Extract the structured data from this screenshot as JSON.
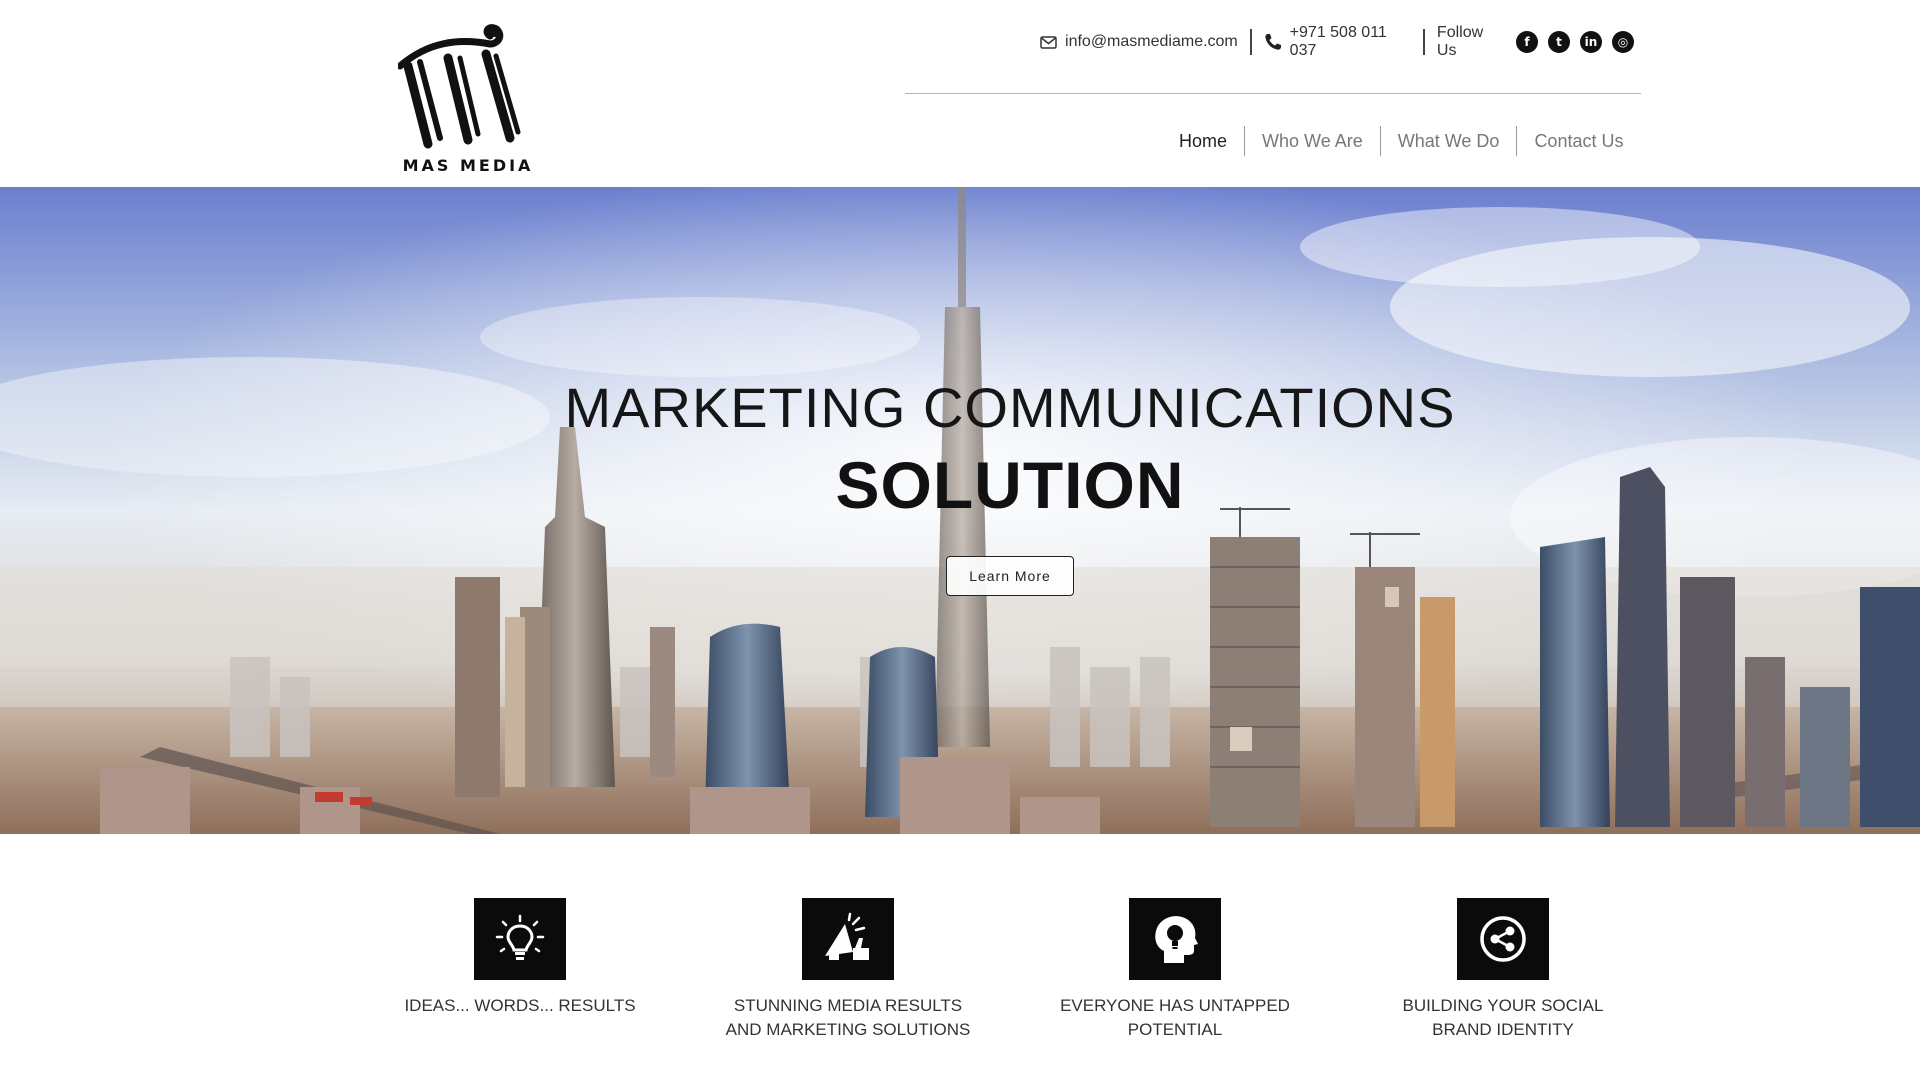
{
  "header": {
    "logo_text": "MAS MEDIA",
    "contact": {
      "email": "info@masmediame.com",
      "phone": "+971 508 011 037",
      "follow_label": "Follow Us",
      "social": [
        {
          "icon": "facebook-icon",
          "glyph": "f"
        },
        {
          "icon": "twitter-icon",
          "glyph": "t"
        },
        {
          "icon": "linkedin-icon",
          "glyph": "in"
        },
        {
          "icon": "instagram-icon",
          "glyph": "◎"
        }
      ]
    },
    "nav": [
      {
        "label": "Home",
        "active": true
      },
      {
        "label": "Who We Are",
        "active": false
      },
      {
        "label": "What We Do",
        "active": false
      },
      {
        "label": "Contact Us",
        "active": false
      }
    ]
  },
  "hero": {
    "title_line1": "MARKETING COMMUNICATIONS",
    "title_line2": "SOLUTION",
    "button_label": "Learn More"
  },
  "features": [
    {
      "icon": "lightbulb-icon",
      "label_line1": "IDEAS... WORDS... RESULTS",
      "label_line2": ""
    },
    {
      "icon": "megaphone-icon",
      "label_line1": "STUNNING MEDIA RESULTS",
      "label_line2": "AND MARKETING SOLUTIONS"
    },
    {
      "icon": "head-bulb-icon",
      "label_line1": "EVERYONE HAS UNTAPPED",
      "label_line2": "POTENTIAL"
    },
    {
      "icon": "share-icon",
      "label_line1": "BUILDING YOUR SOCIAL",
      "label_line2": "BRAND IDENTITY"
    }
  ],
  "colors": {
    "text_dark": "#111111",
    "nav_inactive": "#777777",
    "icon_tile": "#0b0b0b",
    "sky_top": "#6f84d2",
    "sky_light": "#e8eef4"
  }
}
